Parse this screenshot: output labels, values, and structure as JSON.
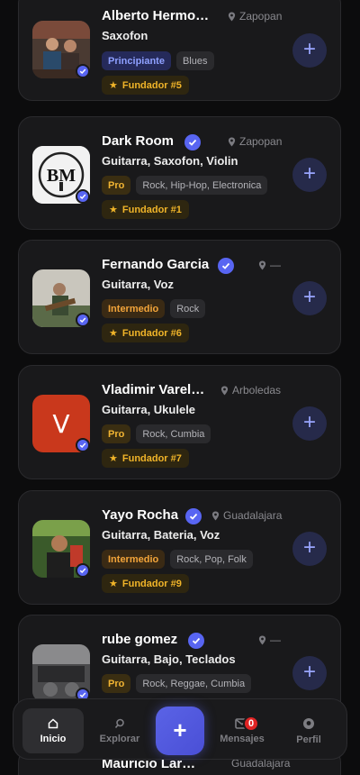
{
  "musicians": [
    {
      "name": "Alberto Hermo…",
      "location": "Zapopan",
      "instruments": "Saxofon",
      "level": "Principiante",
      "level_style": "beg",
      "genres": "Blues",
      "founder": "Fundador #5",
      "avatar": "photo-group"
    },
    {
      "name": "Dark Room",
      "location": "Zapopan",
      "instruments": "Guitarra, Saxofon, Violin",
      "level": "Pro",
      "level_style": "pro",
      "genres": "Rock, Hip-Hop, Electronica",
      "founder": "Fundador #1",
      "avatar": "bm-logo",
      "avatar_text": "BM"
    },
    {
      "name": "Fernando Garcia",
      "location": "—",
      "instruments": "Guitarra, Voz",
      "level": "Intermedio",
      "level_style": "mid",
      "genres": "Rock",
      "founder": "Fundador #6",
      "avatar": "photo-guitarist"
    },
    {
      "name": "Vladimir Varel…",
      "location": "Arboledas",
      "instruments": "Guitarra, Ukulele",
      "level": "Pro",
      "level_style": "pro",
      "genres": "Rock, Cumbia",
      "founder": "Fundador #7",
      "avatar": "initial",
      "avatar_text": "V"
    },
    {
      "name": "Yayo Rocha",
      "location": "Guadalajara",
      "instruments": "Guitarra, Bateria, Voz",
      "level": "Intermedio",
      "level_style": "mid",
      "genres": "Rock, Pop, Folk",
      "founder": "Fundador #9",
      "avatar": "photo-portrait"
    },
    {
      "name": "rube gomez",
      "location": "—",
      "instruments": "Guitarra, Bajo, Teclados",
      "level": "Pro",
      "level_style": "pro",
      "genres": "Rock, Reggae, Cumbia",
      "founder": "",
      "avatar": "photo-studio"
    }
  ],
  "peek": {
    "name": "Mauricio Lar…",
    "location": "Guadalajara"
  },
  "nav": {
    "items": [
      {
        "label": "Inicio",
        "icon": "home-icon",
        "active": true
      },
      {
        "label": "Explorar",
        "icon": "search-icon"
      },
      {
        "label": "Mensajes",
        "icon": "mail-icon",
        "badge": "0"
      },
      {
        "label": "Perfil",
        "icon": "profile-icon"
      }
    ],
    "fab_icon": "plus-icon"
  },
  "colors": {
    "accent": "#5865f2",
    "background": "#0c0c0d",
    "card": "#19191b",
    "founder": "#f0b429"
  }
}
